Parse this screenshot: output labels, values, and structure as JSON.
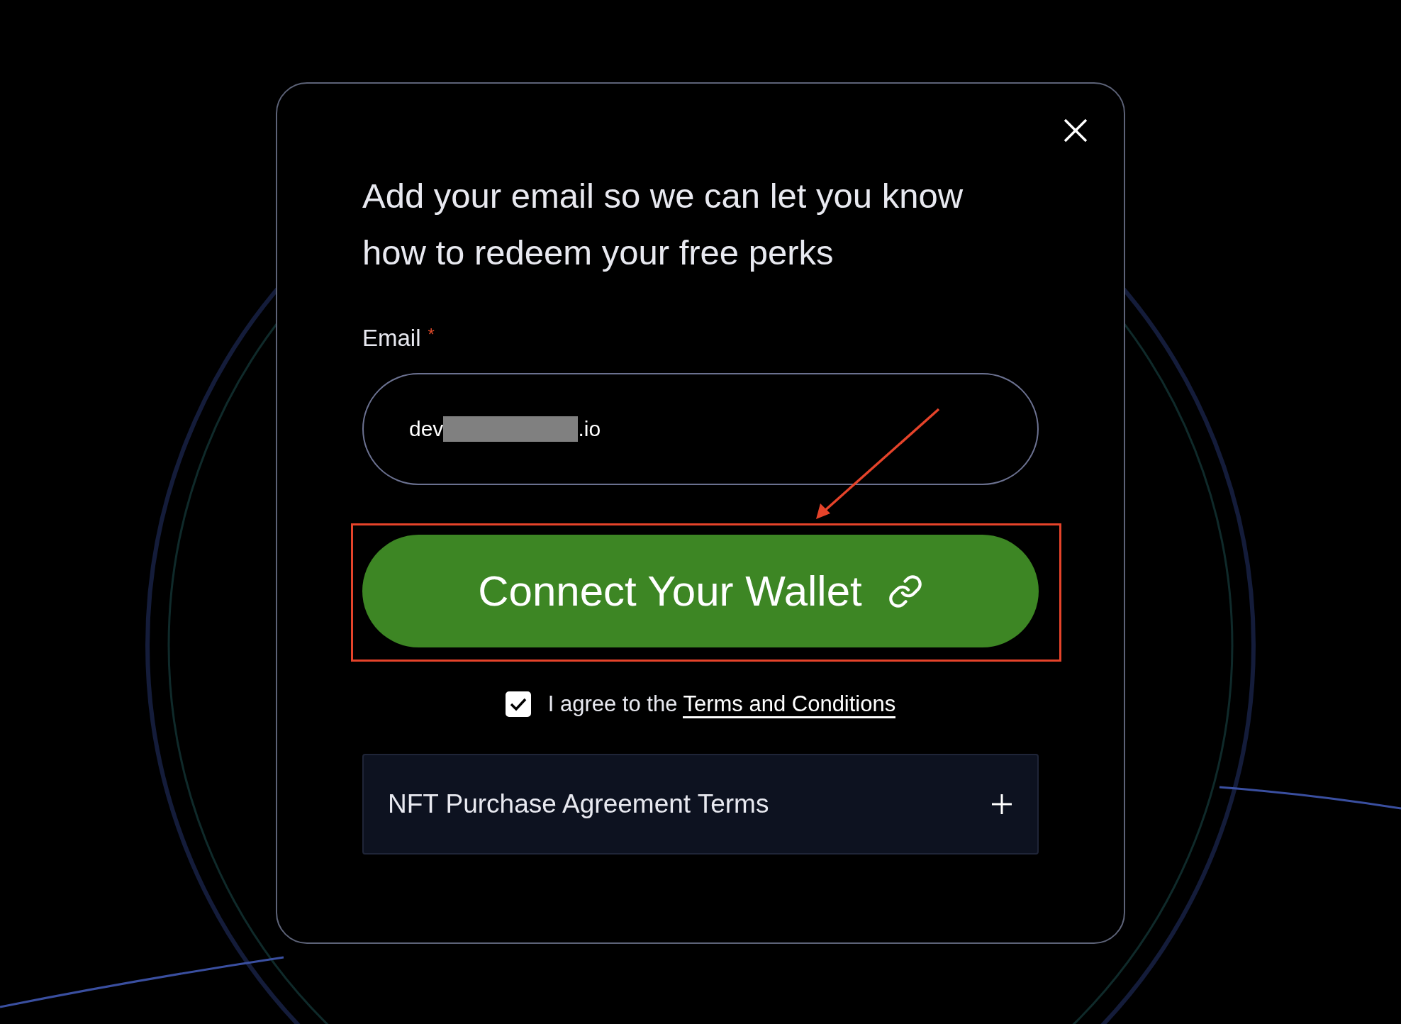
{
  "dialog": {
    "title": "Add your email so we can let you know how to redeem your free perks",
    "email": {
      "label": "Email",
      "required_mark": "*",
      "value_start": "dev",
      "value_end": ".io",
      "redacted": true
    },
    "connect_button": {
      "label": "Connect Your Wallet"
    },
    "agreement": {
      "text": "I agree to the",
      "link": "Terms and Conditions",
      "checked": true
    },
    "accordion": [
      {
        "label": "NFT Purchase Agreement Terms",
        "expanded": false
      }
    ]
  }
}
